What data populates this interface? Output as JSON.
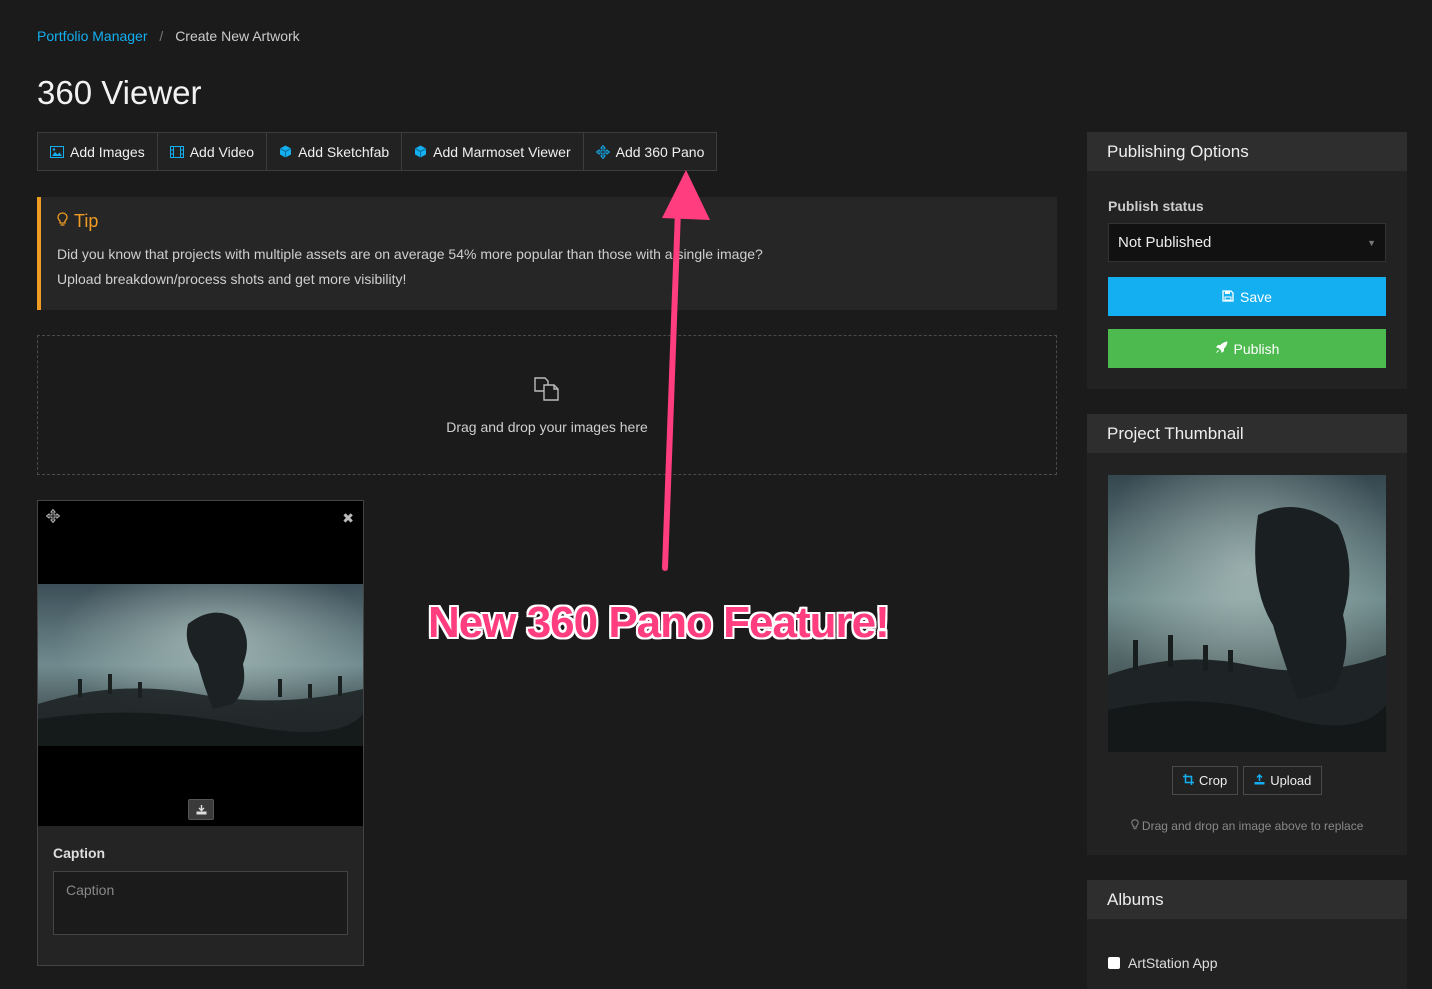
{
  "breadcrumb": {
    "parent": "Portfolio Manager",
    "separator": "/",
    "current": "Create New Artwork"
  },
  "page_title": "360 Viewer",
  "toolbar": [
    {
      "label": "Add Images",
      "icon": "image-icon"
    },
    {
      "label": "Add Video",
      "icon": "film-icon"
    },
    {
      "label": "Add Sketchfab",
      "icon": "cube-icon"
    },
    {
      "label": "Add Marmoset Viewer",
      "icon": "cube-icon"
    },
    {
      "label": "Add 360 Pano",
      "icon": "move-icon"
    }
  ],
  "tip": {
    "title": "Tip",
    "line1": "Did you know that projects with multiple assets are on average 54% more popular than those with a single image?",
    "line2": "Upload breakdown/process shots and get more visibility!"
  },
  "dropzone": {
    "text": "Drag and drop your images here"
  },
  "asset": {
    "caption_label": "Caption",
    "caption_placeholder": "Caption",
    "caption_value": ""
  },
  "annotation": {
    "text": "New 360 Pano Feature!",
    "color": "#ff3d7f"
  },
  "publishing": {
    "title": "Publishing Options",
    "status_label": "Publish status",
    "status_value": "Not Published",
    "save_label": "Save",
    "publish_label": "Publish"
  },
  "thumbnail": {
    "title": "Project Thumbnail",
    "crop_label": "Crop",
    "upload_label": "Upload",
    "hint": "Drag and drop an image above to replace"
  },
  "albums": {
    "title": "Albums",
    "items": [
      {
        "label": "ArtStation App",
        "checked": false
      }
    ]
  },
  "colors": {
    "accent": "#13aff0",
    "publish": "#4cba4e",
    "tip": "#f09b23",
    "background": "#1b1b1b"
  }
}
